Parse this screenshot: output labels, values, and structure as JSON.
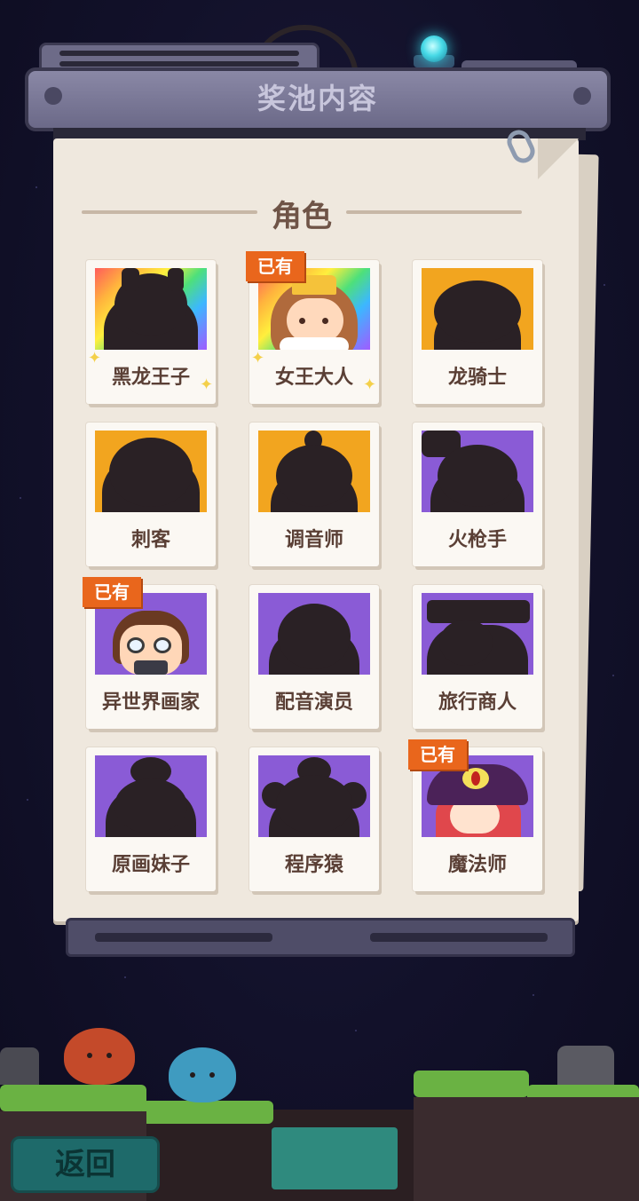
{
  "header": {
    "title": "奖池内容"
  },
  "section": {
    "title": "角色"
  },
  "owned_badge_text": "已有",
  "characters": [
    {
      "name": "黑龙王子",
      "background": "rainbow",
      "owned": false
    },
    {
      "name": "女王大人",
      "background": "rainbow",
      "owned": true
    },
    {
      "name": "龙骑士",
      "background": "orange",
      "owned": false
    },
    {
      "name": "刺客",
      "background": "orange",
      "owned": false
    },
    {
      "name": "调音师",
      "background": "orange",
      "owned": false
    },
    {
      "name": "火枪手",
      "background": "purple",
      "owned": false
    },
    {
      "name": "异世界画家",
      "background": "purple",
      "owned": true
    },
    {
      "name": "配音演员",
      "background": "purple",
      "owned": false
    },
    {
      "name": "旅行商人",
      "background": "purple",
      "owned": false
    },
    {
      "name": "原画妹子",
      "background": "purple",
      "owned": false
    },
    {
      "name": "程序猿",
      "background": "purple",
      "owned": false
    },
    {
      "name": "魔法师",
      "background": "purple",
      "owned": true
    }
  ],
  "back_button": {
    "label": "返回"
  },
  "colors": {
    "badge": "#e9661c",
    "rarity_orange": "#f2a51f",
    "rarity_purple": "#8a5bd6",
    "paper": "#efe8de",
    "name_text": "#5a3f35"
  }
}
